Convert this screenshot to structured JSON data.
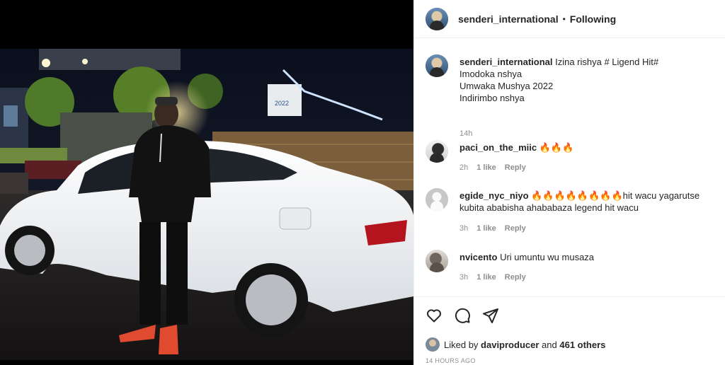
{
  "post": {
    "username": "senderi_international",
    "separator": "•",
    "follow_status": "Following",
    "caption_lines": [
      "Izina rishya # Ligend Hit#",
      "Imodoka nshya",
      "Umwaka Mushya 2022",
      "Indirimbo nshya"
    ],
    "caption_age": "14h"
  },
  "comments": [
    {
      "username": "paci_on_the_miic",
      "text": "🔥🔥🔥",
      "age": "2h",
      "likes": "1 like",
      "reply": "Reply"
    },
    {
      "username": "egide_nyc_niyo",
      "text": "🔥🔥🔥🔥🔥🔥🔥🔥hit wacu yagarutse kubita ababisha ahababaza legend hit wacu",
      "age": "3h",
      "likes": "1 like",
      "reply": "Reply"
    },
    {
      "username": "nvicento",
      "text": "Uri umuntu wu musaza",
      "age": "3h",
      "likes": "1 like",
      "reply": "Reply"
    }
  ],
  "actions": {
    "icons": [
      "heart-icon",
      "comment-icon",
      "share-icon"
    ]
  },
  "likes": {
    "prefix": "Liked by",
    "liker": "daviproducer",
    "and": "and",
    "others": "461 others"
  },
  "timestamp": "14 HOURS AGO",
  "photo": {
    "sign_text": "2022"
  }
}
